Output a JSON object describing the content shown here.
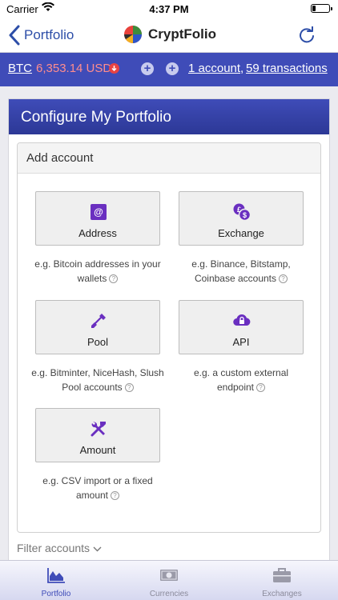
{
  "status": {
    "carrier": "Carrier",
    "time": "4:37 PM"
  },
  "nav": {
    "back_label": "Portfolio",
    "title": "CryptFolio"
  },
  "ticker": {
    "symbol": "BTC",
    "price": "6,353.14 USD",
    "accounts": "1 account",
    "separator": ",",
    "transactions": "59 transactions"
  },
  "page": {
    "title": "Configure My Portfolio"
  },
  "panel": {
    "title": "Add account"
  },
  "options": [
    {
      "label": "Address",
      "desc1": "e.g. Bitcoin addresses in your",
      "desc2": "wallets",
      "icon": "address-icon"
    },
    {
      "label": "Exchange",
      "desc1": "e.g. Binance, Bitstamp,",
      "desc2": "Coinbase accounts",
      "icon": "exchange-icon"
    },
    {
      "label": "Pool",
      "desc1": "e.g. Bitminter, NiceHash, Slush",
      "desc2": "Pool accounts",
      "icon": "shovel-icon"
    },
    {
      "label": "API",
      "desc1": "e.g. a custom external",
      "desc2": "endpoint",
      "icon": "cloud-lock-icon"
    },
    {
      "label": "Amount",
      "desc1": "e.g. CSV import or a fixed",
      "desc2": "amount",
      "icon": "tools-icon"
    }
  ],
  "help_glyph": "?",
  "filter": {
    "label": "Filter accounts"
  },
  "tabs": [
    {
      "label": "Portfolio",
      "icon": "area-chart-icon",
      "active": true
    },
    {
      "label": "Currencies",
      "icon": "banknote-icon",
      "active": false
    },
    {
      "label": "Exchanges",
      "icon": "briefcase-icon",
      "active": false
    }
  ],
  "colors": {
    "brand": "#3f4cb8",
    "price_down": "#ff8d8d",
    "icon_purple": "#6a2fc0"
  }
}
